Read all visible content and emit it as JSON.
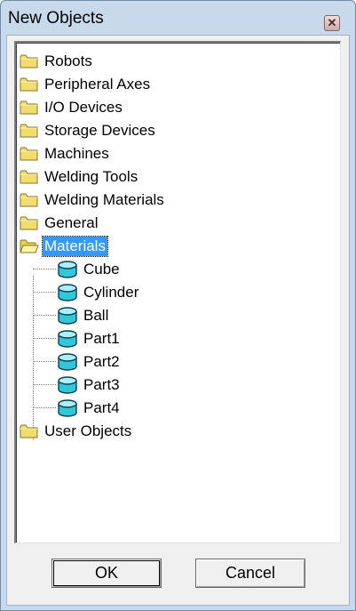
{
  "window": {
    "title": "New Objects",
    "close_glyph": "✕"
  },
  "tree": {
    "top_folders": [
      {
        "label": "Robots",
        "icon": "folder-icon"
      },
      {
        "label": "Peripheral Axes",
        "icon": "folder-icon"
      },
      {
        "label": "I/O Devices",
        "icon": "folder-icon"
      },
      {
        "label": "Storage Devices",
        "icon": "folder-icon"
      },
      {
        "label": "Machines",
        "icon": "folder-icon"
      },
      {
        "label": "Welding Tools",
        "icon": "folder-icon"
      },
      {
        "label": "Welding Materials",
        "icon": "folder-icon"
      },
      {
        "label": "General",
        "icon": "folder-icon"
      }
    ],
    "expanded_folder": {
      "label": "Materials",
      "icon": "open-folder-icon",
      "selected": true
    },
    "materials": [
      {
        "label": "Cube",
        "icon": "cylinder-icon"
      },
      {
        "label": "Cylinder",
        "icon": "cylinder-icon"
      },
      {
        "label": "Ball",
        "icon": "cylinder-icon"
      },
      {
        "label": "Part1",
        "icon": "cylinder-icon"
      },
      {
        "label": "Part2",
        "icon": "cylinder-icon"
      },
      {
        "label": "Part3",
        "icon": "cylinder-icon"
      },
      {
        "label": "Part4",
        "icon": "cylinder-icon"
      }
    ],
    "last_folder": {
      "label": "User Objects",
      "icon": "folder-icon"
    }
  },
  "buttons": {
    "ok": "OK",
    "cancel": "Cancel"
  },
  "colors": {
    "selection": "#3399ff",
    "folder": "#f2dc6e",
    "cylinder": "#33c6d6"
  }
}
